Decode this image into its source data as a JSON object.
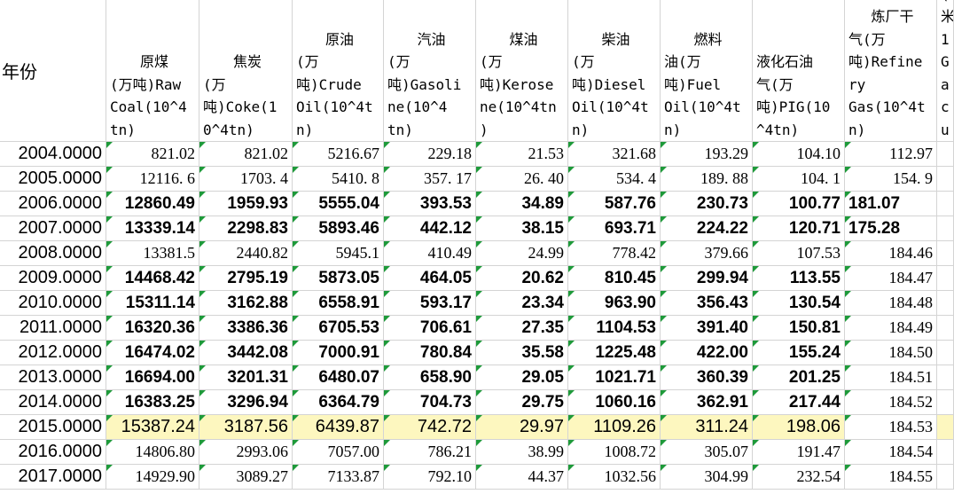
{
  "sheet": {
    "year_header": "年份",
    "headers": [
      [
        "",
        "原煤",
        "(万吨)Raw",
        "Coal(10^4",
        "tn)"
      ],
      [
        "",
        "焦炭",
        "(万",
        "吨)Coke(1",
        "0^4tn)"
      ],
      [
        "原油",
        "(万",
        "吨)Crude",
        "Oil(10^4t",
        "n)"
      ],
      [
        "汽油",
        "(万",
        "吨)Gasoli",
        "ne(10^4",
        "tn)"
      ],
      [
        "煤油",
        "(万",
        "吨)Kerose",
        "ne(10^4tn",
        ")"
      ],
      [
        "柴油",
        "(万",
        "吨)Diesel",
        "Oil(10^4t",
        "n)"
      ],
      [
        "燃料",
        "油(万",
        "吨)Fuel",
        "Oil(10^4t",
        "n)"
      ],
      [
        "",
        "液化石油",
        "气(万",
        "吨)PIG(10",
        "^4tn)"
      ],
      [
        "炼厂干",
        "气(万",
        "吨)Refine",
        "ry",
        "Gas(10^4t",
        "n)"
      ],
      [
        "(",
        "米",
        "1",
        "Ga",
        "cu"
      ]
    ],
    "rows": [
      {
        "year": "2004.0000",
        "v": [
          "821.02",
          "821.02",
          "5216.67",
          "229.18",
          "21.53",
          "321.68",
          "193.29",
          "104.10",
          "112.97",
          ""
        ]
      },
      {
        "year": "2005.0000",
        "v": [
          "12116. 6",
          "1703. 4",
          "5410. 8",
          "357. 17",
          "26. 40",
          "534. 4",
          "189. 88",
          "104. 1",
          "154. 9",
          ""
        ]
      },
      {
        "year": "2006.0000",
        "v": [
          "12860.49",
          "1959.93",
          "5555.04",
          "393.53",
          "34.89",
          "587.76",
          "230.73",
          "100.77",
          "181.07",
          ""
        ]
      },
      {
        "year": "2007.0000",
        "v": [
          "13339.14",
          "2298.83",
          "5893.46",
          "442.12",
          "38.15",
          "693.71",
          "224.22",
          "120.71",
          "175.28",
          ""
        ]
      },
      {
        "year": "2008.0000",
        "v": [
          "13381.5",
          "2440.82",
          "5945.1",
          "410.49",
          "24.99",
          "778.42",
          "379.66",
          "107.53",
          "184.46",
          ""
        ]
      },
      {
        "year": "2009.0000",
        "v": [
          "14468.42",
          "2795.19",
          "5873.05",
          "464.05",
          "20.62",
          "810.45",
          "299.94",
          "113.55",
          "184.47",
          ""
        ]
      },
      {
        "year": "2010.0000",
        "v": [
          "15311.14",
          "3162.88",
          "6558.91",
          "593.17",
          "23.34",
          "963.90",
          "356.43",
          "130.54",
          "184.48",
          ""
        ]
      },
      {
        "year": "2011.0000",
        "v": [
          "16320.36",
          "3386.36",
          "6705.53",
          "706.61",
          "27.35",
          "1104.53",
          "391.40",
          "150.81",
          "184.49",
          ""
        ]
      },
      {
        "year": "2012.0000",
        "v": [
          "16474.02",
          "3442.08",
          "7000.91",
          "780.84",
          "35.58",
          "1225.48",
          "422.00",
          "155.24",
          "184.50",
          ""
        ]
      },
      {
        "year": "2013.0000",
        "v": [
          "16694.00",
          "3201.31",
          "6480.07",
          "658.90",
          "29.05",
          "1021.71",
          "360.39",
          "201.25",
          "184.51",
          ""
        ]
      },
      {
        "year": "2014.0000",
        "v": [
          "16383.25",
          "3296.94",
          "6364.79",
          "704.73",
          "29.75",
          "1060.16",
          "362.91",
          "217.44",
          "184.52",
          ""
        ]
      },
      {
        "year": "2015.0000",
        "v": [
          "15387.24",
          "3187.56",
          "6439.87",
          "742.72",
          "29.97",
          "1109.26",
          "311.24",
          "198.06",
          "184.53",
          ""
        ]
      },
      {
        "year": "2016.0000",
        "v": [
          "14806.80",
          "2993.06",
          "7057.00",
          "786.21",
          "38.99",
          "1008.72",
          "305.07",
          "191.47",
          "184.54",
          ""
        ]
      },
      {
        "year": "2017.0000",
        "v": [
          "14929.90",
          "3089.27",
          "7133.87",
          "792.10",
          "44.37",
          "1032.56",
          "304.99",
          "232.54",
          "184.55",
          ""
        ]
      }
    ],
    "row_styles": [
      "serif",
      "serif",
      "bold",
      "bold",
      "serif",
      "bold",
      "bold",
      "bold",
      "bold",
      "bold",
      "bold",
      "hl",
      "serif",
      "serif"
    ],
    "row_triangles": [
      true,
      true,
      true,
      true,
      true,
      true,
      true,
      true,
      true,
      true,
      true,
      true,
      true,
      true
    ],
    "colors": {
      "highlight": "#fdf7bf",
      "marker": "#1e9a3a",
      "grid": "#d4d4d4"
    }
  }
}
